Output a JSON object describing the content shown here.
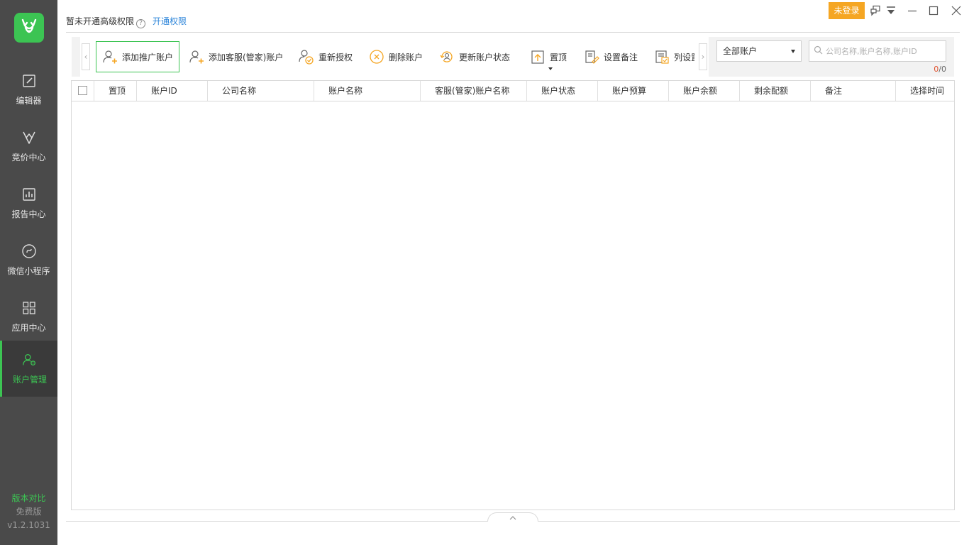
{
  "sidebar": {
    "logo_icon": "antler-logo-icon",
    "brand_color": "#3cc453",
    "items": [
      {
        "label": "编辑器",
        "icon": "edit-icon"
      },
      {
        "label": "竞价中心",
        "icon": "bid-icon"
      },
      {
        "label": "报告中心",
        "icon": "report-icon"
      },
      {
        "label": "微信小程序",
        "icon": "mini-program-icon"
      },
      {
        "label": "应用中心",
        "icon": "app-grid-icon"
      },
      {
        "label": "账户管理",
        "icon": "account-manage-icon",
        "active": true
      }
    ],
    "footer": {
      "compare_label": "版本对比",
      "edition": "免费版",
      "version": "v1.2.1031"
    }
  },
  "topbar": {
    "permission_text": "暂未开通高级权限",
    "permission_link": "开通权限",
    "login_button": "未登录",
    "login_color": "#f5a623"
  },
  "toolbar": {
    "buttons": [
      {
        "label": "添加推广账户",
        "icon": "add-user-icon"
      },
      {
        "label": "添加客服(管家)账户",
        "icon": "add-service-user-icon"
      },
      {
        "label": "重新授权",
        "icon": "reauthorize-icon"
      },
      {
        "label": "删除账户",
        "icon": "delete-icon"
      },
      {
        "label": "更新账户状态",
        "icon": "refresh-user-icon"
      },
      {
        "label": "置顶",
        "icon": "pin-top-icon"
      },
      {
        "label": "设置备注",
        "icon": "note-icon"
      },
      {
        "label": "列设置",
        "icon": "column-settings-icon"
      }
    ],
    "account_filter": "全部账户",
    "search_placeholder": "公司名称,账户名称,账户ID",
    "count_current": "0",
    "count_separator": "/",
    "count_total": "0"
  },
  "table": {
    "columns": [
      "置顶",
      "账户ID",
      "公司名称",
      "账户名称",
      "客服(管家)账户名称",
      "账户状态",
      "账户预算",
      "账户余额",
      "剩余配额",
      "备注",
      "选择时间"
    ],
    "rows": []
  }
}
